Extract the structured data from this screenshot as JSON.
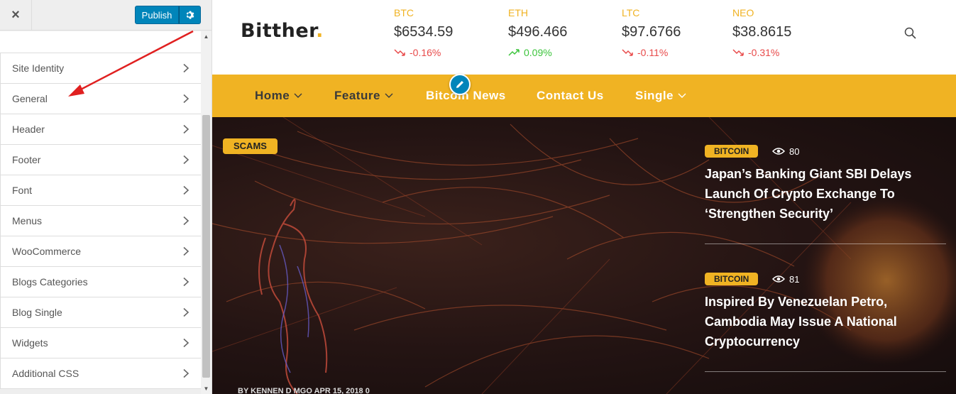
{
  "sidebar": {
    "close_label": "×",
    "publish_label": "Publish",
    "menu": [
      {
        "label": "Site Identity"
      },
      {
        "label": "General"
      },
      {
        "label": "Header"
      },
      {
        "label": "Footer"
      },
      {
        "label": "Font"
      },
      {
        "label": "Menus"
      },
      {
        "label": "WooCommerce"
      },
      {
        "label": "Blogs Categories"
      },
      {
        "label": "Blog Single"
      },
      {
        "label": "Widgets"
      },
      {
        "label": "Additional CSS"
      }
    ]
  },
  "site": {
    "logo_text": "Bitther",
    "logo_dot": ".",
    "tickers": [
      {
        "symbol": "BTC",
        "price": "$6534.59",
        "change": "-0.16%",
        "direction": "down"
      },
      {
        "symbol": "ETH",
        "price": "$496.466",
        "change": "0.09%",
        "direction": "up"
      },
      {
        "symbol": "LTC",
        "price": "$97.6766",
        "change": "-0.11%",
        "direction": "down"
      },
      {
        "symbol": "NEO",
        "price": "$38.8615",
        "change": "-0.31%",
        "direction": "down"
      }
    ],
    "nav": [
      {
        "label": "Home",
        "dropdown": true
      },
      {
        "label": "Feature",
        "dropdown": true
      },
      {
        "label": "Bitcoin News",
        "dropdown": false
      },
      {
        "label": "Contact Us",
        "dropdown": false
      },
      {
        "label": "Single",
        "dropdown": true
      }
    ],
    "hero": {
      "category": "SCAMS",
      "byline": "BY KENNEN D MGO    APR 15, 2018    0"
    },
    "posts": [
      {
        "category": "BITCOIN",
        "views": "80",
        "title": "Japan’s Banking Giant SBI Delays Launch Of Crypto Exchange To ‘Strengthen Security’"
      },
      {
        "category": "BITCOIN",
        "views": "81",
        "title": "Inspired By Venezuelan Petro, Cambodia May Issue A National Cryptocurrency"
      }
    ]
  },
  "colors": {
    "accent": "#f0b323",
    "wp_blue": "#0085ba",
    "down": "#e84a4a",
    "up": "#3bc43b",
    "annotation_arrow": "#e02020"
  }
}
